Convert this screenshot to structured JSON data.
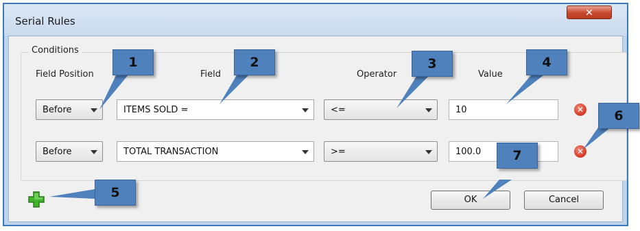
{
  "dialog": {
    "title": "Serial Rules",
    "close_label": "✕",
    "group_title": "Conditions",
    "columns": {
      "position": "Field Position",
      "field": "Field",
      "operator": "Operator",
      "value": "Value"
    },
    "rows": [
      {
        "position": "Before",
        "field": "ITEMS SOLD =",
        "operator": "<=",
        "value": "10"
      },
      {
        "position": "Before",
        "field": "TOTAL TRANSACTION",
        "operator": ">=",
        "value": "100.0"
      }
    ],
    "delete_glyph": "✕",
    "ok_label": "OK",
    "cancel_label": "Cancel"
  },
  "callouts": [
    "1",
    "2",
    "3",
    "4",
    "5",
    "6",
    "7"
  ],
  "colors": {
    "callout_fill": "#4f81bd",
    "frame_border": "#3a78c2",
    "delete_red": "#d9412b",
    "add_green": "#3fb42a"
  },
  "icons": {
    "add": "add-plus-icon",
    "delete": "delete-circle-icon",
    "close": "close-icon"
  }
}
